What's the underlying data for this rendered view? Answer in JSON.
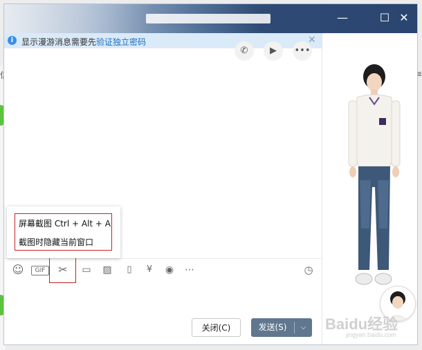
{
  "window": {
    "title": "———",
    "controls": {
      "minimize": "—",
      "maximize": "☐",
      "close": "✕"
    }
  },
  "notice": {
    "text": "显示漫游消息需要先",
    "link": "验证独立密码",
    "icon": "info-icon",
    "close": "✕"
  },
  "chat_actions": [
    {
      "name": "phone-icon",
      "glyph": "✆"
    },
    {
      "name": "video-icon",
      "glyph": "▶"
    },
    {
      "name": "more-icon",
      "glyph": "•••"
    }
  ],
  "tooltip": {
    "line1": "屏幕截图 Ctrl + Alt + A",
    "line2": "截图时隐藏当前窗口"
  },
  "toolbar": {
    "emoji": "☺",
    "gif": "GIF",
    "cut": "✂",
    "folder": "▭",
    "image": "▨",
    "shake": "▯",
    "yuan": "¥",
    "music": "◉",
    "dots": "⋯",
    "history": "◷"
  },
  "buttons": {
    "close": "关闭(C)",
    "send": "发送(S)",
    "send_arrow": "⌵"
  },
  "watermark": {
    "main": "Baidu经验",
    "sub": "jingyan.baidu.com"
  },
  "desktop": {
    "left_char": "信",
    "right_char": "≡"
  }
}
